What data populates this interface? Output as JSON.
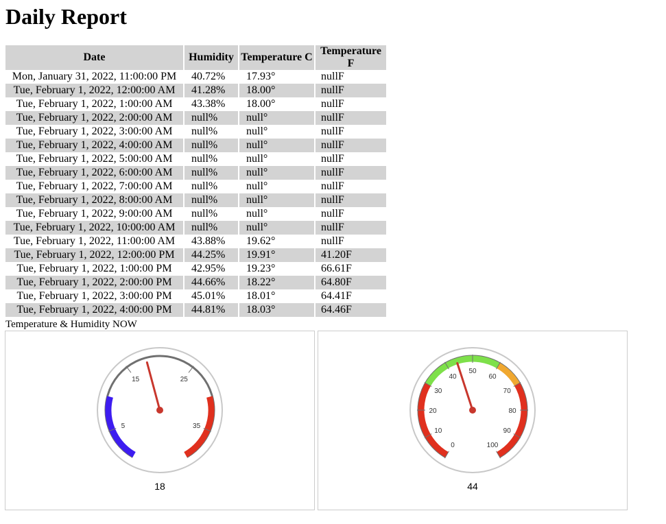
{
  "page": {
    "title": "Daily Report"
  },
  "table": {
    "headers": {
      "date": "Date",
      "humidity": "Humidity",
      "temp_c": "Temperature C",
      "temp_f": "Temperature F"
    },
    "rows": [
      {
        "date": "Mon, January 31, 2022, 11:00:00 PM",
        "humidity": "40.72%",
        "temp_c": "17.93°",
        "temp_f": "nullF"
      },
      {
        "date": "Tue, February 1, 2022, 12:00:00 AM",
        "humidity": "41.28%",
        "temp_c": "18.00°",
        "temp_f": "nullF"
      },
      {
        "date": "Tue, February 1, 2022, 1:00:00 AM",
        "humidity": "43.38%",
        "temp_c": "18.00°",
        "temp_f": "nullF"
      },
      {
        "date": "Tue, February 1, 2022, 2:00:00 AM",
        "humidity": "null%",
        "temp_c": "null°",
        "temp_f": "nullF"
      },
      {
        "date": "Tue, February 1, 2022, 3:00:00 AM",
        "humidity": "null%",
        "temp_c": "null°",
        "temp_f": "nullF"
      },
      {
        "date": "Tue, February 1, 2022, 4:00:00 AM",
        "humidity": "null%",
        "temp_c": "null°",
        "temp_f": "nullF"
      },
      {
        "date": "Tue, February 1, 2022, 5:00:00 AM",
        "humidity": "null%",
        "temp_c": "null°",
        "temp_f": "nullF"
      },
      {
        "date": "Tue, February 1, 2022, 6:00:00 AM",
        "humidity": "null%",
        "temp_c": "null°",
        "temp_f": "nullF"
      },
      {
        "date": "Tue, February 1, 2022, 7:00:00 AM",
        "humidity": "null%",
        "temp_c": "null°",
        "temp_f": "nullF"
      },
      {
        "date": "Tue, February 1, 2022, 8:00:00 AM",
        "humidity": "null%",
        "temp_c": "null°",
        "temp_f": "nullF"
      },
      {
        "date": "Tue, February 1, 2022, 9:00:00 AM",
        "humidity": "null%",
        "temp_c": "null°",
        "temp_f": "nullF"
      },
      {
        "date": "Tue, February 1, 2022, 10:00:00 AM",
        "humidity": "null%",
        "temp_c": "null°",
        "temp_f": "nullF"
      },
      {
        "date": "Tue, February 1, 2022, 11:00:00 AM",
        "humidity": "43.88%",
        "temp_c": "19.62°",
        "temp_f": "nullF"
      },
      {
        "date": "Tue, February 1, 2022, 12:00:00 PM",
        "humidity": "44.25%",
        "temp_c": "19.91°",
        "temp_f": "41.20F"
      },
      {
        "date": "Tue, February 1, 2022, 1:00:00 PM",
        "humidity": "42.95%",
        "temp_c": "19.23°",
        "temp_f": "66.61F"
      },
      {
        "date": "Tue, February 1, 2022, 2:00:00 PM",
        "humidity": "44.66%",
        "temp_c": "18.22°",
        "temp_f": "64.80F"
      },
      {
        "date": "Tue, February 1, 2022, 3:00:00 PM",
        "humidity": "45.01%",
        "temp_c": "18.01°",
        "temp_f": "64.41F"
      },
      {
        "date": "Tue, February 1, 2022, 4:00:00 PM",
        "humidity": "44.81%",
        "temp_c": "18.03°",
        "temp_f": "64.46F"
      }
    ]
  },
  "now": {
    "caption": "Temperature & Humidity NOW",
    "temperature": {
      "value": 18,
      "value_label": "18",
      "min": 0,
      "max": 40,
      "ticks": [
        "5",
        "15",
        "25",
        "35"
      ],
      "tick_values": [
        5,
        15,
        25,
        35
      ],
      "bands": [
        {
          "from": 0,
          "to": 10,
          "color": "#3d1cf0"
        },
        {
          "from": 30,
          "to": 40,
          "color": "#e0301e"
        }
      ]
    },
    "humidity": {
      "value": 44,
      "value_label": "44",
      "min": 0,
      "max": 100,
      "ticks": [
        "0",
        "10",
        "20",
        "30",
        "40",
        "50",
        "60",
        "70",
        "80",
        "90",
        "100"
      ],
      "tick_values": [
        0,
        10,
        20,
        30,
        40,
        50,
        60,
        70,
        80,
        90,
        100
      ],
      "bands": [
        {
          "from": 0,
          "to": 30,
          "color": "#e0301e"
        },
        {
          "from": 30,
          "to": 60,
          "color": "#7ee04a"
        },
        {
          "from": 60,
          "to": 70,
          "color": "#f0a830"
        },
        {
          "from": 70,
          "to": 100,
          "color": "#e0301e"
        }
      ]
    }
  },
  "colors": {
    "row_shade": "#d3d3d3",
    "needle": "#c8372d",
    "gauge_frame": "#707070",
    "gauge_ring": "#c8c8c8"
  }
}
